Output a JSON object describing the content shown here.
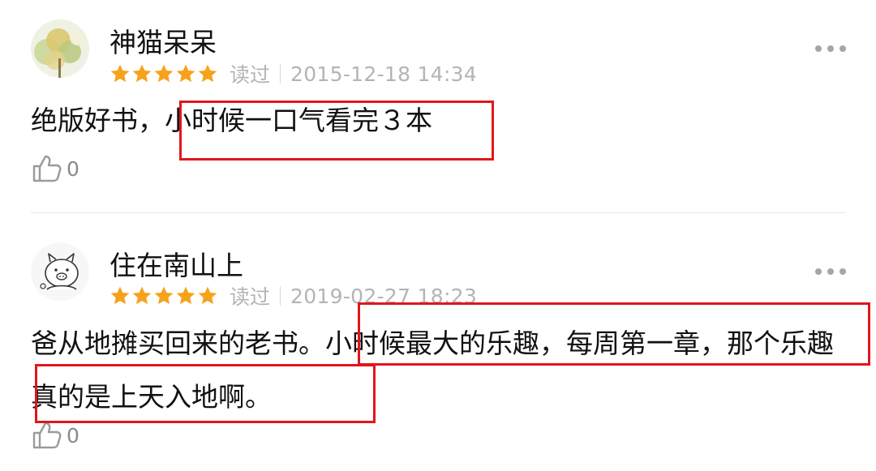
{
  "reviews": [
    {
      "username": "神猫呆呆",
      "rating": 5,
      "status": "读过",
      "datetime": "2015-12-18 14:34",
      "content": "绝版好书，小时候一口气看完３本",
      "likes": "0",
      "avatar_icon": "tree-photo-avatar"
    },
    {
      "username": "住在南山上",
      "rating": 5,
      "status": "读过",
      "datetime": "2019-02-27 18:23",
      "content": "爸从地摊买回来的老书。小时候最大的乐趣，每周第一章，那个乐趣真的是上天入地啊。",
      "likes": "0",
      "avatar_icon": "cartoon-pig-avatar"
    }
  ],
  "icons": {
    "star": "star-icon",
    "like": "thumbs-up-icon",
    "more": "more-options-icon"
  },
  "colors": {
    "star": "#f7a21b",
    "highlight": "#e0161d",
    "meta_text": "#b4b4b4",
    "text": "#111111"
  }
}
